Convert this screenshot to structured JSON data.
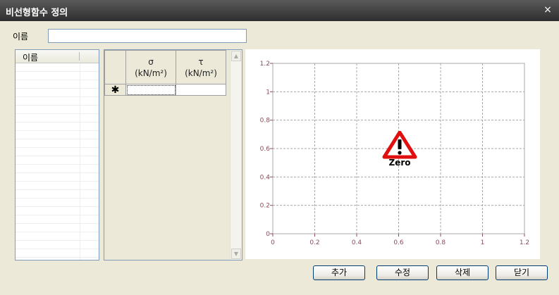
{
  "window": {
    "title": "비선형함수 정의",
    "close_label": "×"
  },
  "name_field": {
    "label": "이름",
    "value": "",
    "placeholder": ""
  },
  "name_list": {
    "header": "이름"
  },
  "grid": {
    "columns": [
      {
        "symbol": "σ",
        "unit": "(kN/m²)"
      },
      {
        "symbol": "τ",
        "unit": "(kN/m²)"
      }
    ],
    "new_row_marker": "✱"
  },
  "chart_data": {
    "type": "line",
    "x": [],
    "series": [],
    "xlim": [
      0,
      1.2
    ],
    "ylim": [
      0,
      1.2
    ],
    "xticks": [
      "0",
      "0.2",
      "0.4",
      "0.6",
      "0.8",
      "1",
      "1.2"
    ],
    "yticks": [
      "0",
      "0.2",
      "0.4",
      "0.6",
      "0.8",
      "1",
      "1.2"
    ],
    "grid": true,
    "tick_color": "#8b4a5a",
    "grid_color": "#a8a8a8",
    "warning_text": "Zero"
  },
  "buttons": {
    "add": "추가",
    "modify": "수정",
    "delete": "삭제",
    "close": "닫기"
  }
}
